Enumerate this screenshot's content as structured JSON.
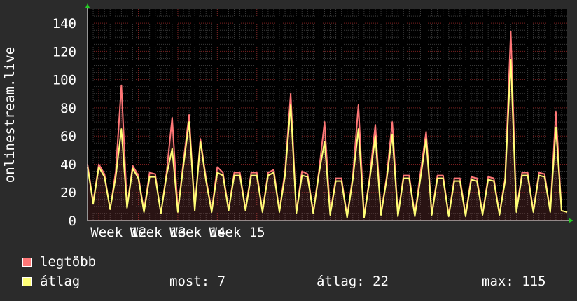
{
  "colors": {
    "background": "#2b2b2b",
    "plot_background": "#000000",
    "grid_minor": "#3a3a3a",
    "grid_major": "#7a1f1f",
    "text": "#ffffff",
    "arrow": "#22cc22",
    "max_series": "#ff7777",
    "avg_series": "#ffff77"
  },
  "chart_data": {
    "type": "area",
    "ylabel": "onlinestream.live",
    "ylim": [
      0,
      150
    ],
    "yticks": [
      0,
      20,
      40,
      60,
      80,
      100,
      120,
      140
    ],
    "xlabels": [
      "Week 12",
      "Week 13",
      "Week 14",
      "Week 15"
    ],
    "x_unit": "days",
    "grid": true,
    "series": [
      {
        "name": "legtöbb",
        "color": "#ff7777",
        "values": [
          40,
          13,
          40,
          33,
          8,
          35,
          96,
          10,
          39,
          32,
          7,
          34,
          33,
          5,
          34,
          73,
          7,
          42,
          75,
          8,
          58,
          30,
          7,
          38,
          34,
          8,
          34,
          34,
          8,
          34,
          34,
          7,
          34,
          36,
          7,
          35,
          90,
          6,
          35,
          33,
          6,
          35,
          70,
          5,
          30,
          30,
          3,
          31,
          82,
          3,
          31,
          68,
          5,
          31,
          70,
          4,
          32,
          32,
          4,
          34,
          63,
          5,
          32,
          32,
          4,
          30,
          30,
          4,
          31,
          30,
          5,
          31,
          30,
          5,
          30,
          134,
          7,
          34,
          34,
          7,
          34,
          33,
          7,
          77,
          7,
          6
        ]
      },
      {
        "name": "átlag",
        "color": "#ffff77",
        "values": [
          38,
          12,
          38,
          31,
          8,
          31,
          65,
          9,
          37,
          30,
          6,
          31,
          31,
          5,
          32,
          51,
          6,
          39,
          70,
          7,
          56,
          28,
          6,
          34,
          32,
          7,
          32,
          32,
          7,
          32,
          32,
          6,
          32,
          34,
          6,
          32,
          82,
          5,
          32,
          31,
          5,
          33,
          56,
          4,
          28,
          28,
          2,
          29,
          65,
          2,
          29,
          60,
          4,
          29,
          61,
          3,
          30,
          30,
          3,
          30,
          58,
          4,
          30,
          30,
          3,
          28,
          28,
          3,
          29,
          28,
          4,
          29,
          28,
          4,
          28,
          114,
          6,
          32,
          32,
          6,
          32,
          31,
          6,
          66,
          7,
          6
        ]
      }
    ]
  },
  "legend": {
    "max_label": "legtöbb",
    "avg_label": "átlag",
    "now_text": "most: 7",
    "avg_text": "átlag: 22",
    "max_text": "max: 115"
  }
}
